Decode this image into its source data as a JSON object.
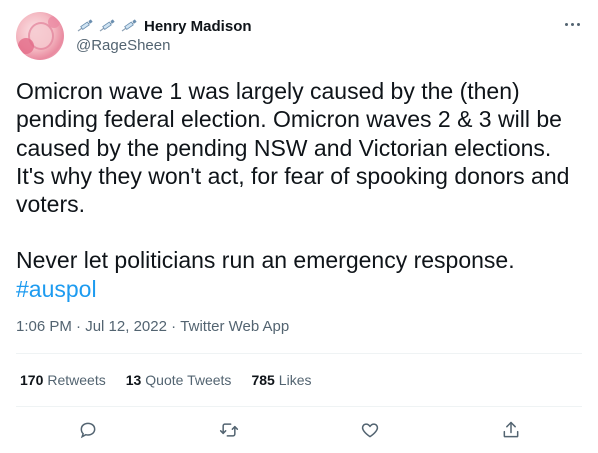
{
  "author": {
    "name": "Henry Madison",
    "handle": "@RageSheen",
    "name_prefix_icons": [
      "syringe-icon",
      "syringe-icon",
      "syringe-icon"
    ]
  },
  "tweet": {
    "paragraph1": "Omicron wave 1 was largely caused by the (then) pending federal election. Omicron waves 2 & 3 will be caused by the pending NSW and Victorian elections. It's why they won't act, for fear of spooking donors and voters.",
    "paragraph2": "Never let politicians run an emergency response.",
    "hashtag": "#auspol"
  },
  "meta": {
    "time": "1:06 PM",
    "separator": " · ",
    "date": "Jul 12, 2022",
    "source": "Twitter Web App"
  },
  "stats": {
    "retweets_count": "170",
    "retweets_label": "Retweets",
    "quotes_count": "13",
    "quotes_label": "Quote Tweets",
    "likes_count": "785",
    "likes_label": "Likes"
  },
  "colors": {
    "accent": "#1d9bf0",
    "text": "#0f1419",
    "secondary": "#536471",
    "divider": "#eff3f4"
  }
}
